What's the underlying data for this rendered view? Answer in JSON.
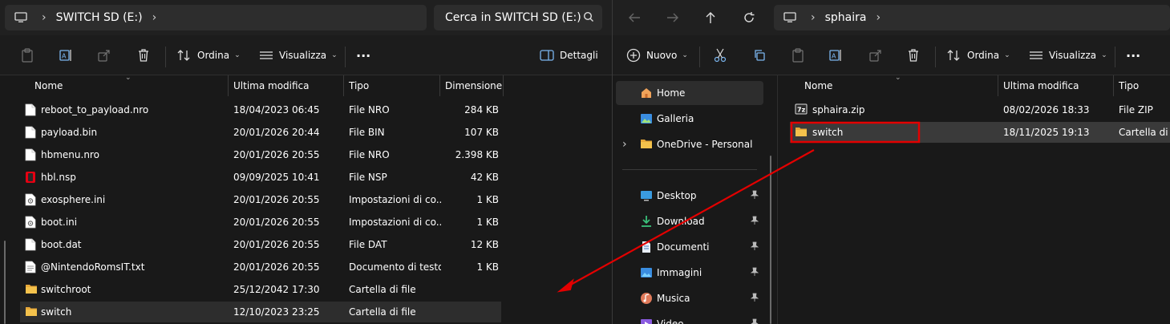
{
  "left": {
    "address": {
      "crumb": "SWITCH SD (E:)"
    },
    "search_placeholder": "Cerca in SWITCH SD (E:)",
    "toolbar": {
      "details_label": "Dettagli",
      "sort_label": "Ordina",
      "view_label": "Visualizza",
      "more": "···"
    },
    "columns": {
      "name": "Nome",
      "modified": "Ultima modifica",
      "type": "Tipo",
      "size": "Dimensione"
    },
    "files": [
      {
        "name": "reboot_to_payload.nro",
        "modified": "18/04/2023 06:45",
        "type": "File NRO",
        "size": "284 KB",
        "icon": "file-icon"
      },
      {
        "name": "payload.bin",
        "modified": "20/01/2026 20:44",
        "type": "File BIN",
        "size": "107 KB",
        "icon": "file-icon"
      },
      {
        "name": "hbmenu.nro",
        "modified": "20/01/2026 20:55",
        "type": "File NRO",
        "size": "2.398 KB",
        "icon": "file-icon"
      },
      {
        "name": "hbl.nsp",
        "modified": "09/09/2025 10:41",
        "type": "File NSP",
        "size": "42 KB",
        "icon": "switch-nsp-icon"
      },
      {
        "name": "exosphere.ini",
        "modified": "20/01/2026 20:55",
        "type": "Impostazioni di co...",
        "size": "1 KB",
        "icon": "settings-file-icon"
      },
      {
        "name": "boot.ini",
        "modified": "20/01/2026 20:55",
        "type": "Impostazioni di co...",
        "size": "1 KB",
        "icon": "settings-file-icon"
      },
      {
        "name": "boot.dat",
        "modified": "20/01/2026 20:55",
        "type": "File DAT",
        "size": "12 KB",
        "icon": "file-icon"
      },
      {
        "name": "@NintendoRomsIT.txt",
        "modified": "20/01/2026 20:55",
        "type": "Documento di testo",
        "size": "1 KB",
        "icon": "text-file-icon"
      },
      {
        "name": "switchroot",
        "modified": "25/12/2042 17:30",
        "type": "Cartella di file",
        "size": "",
        "icon": "folder-icon"
      },
      {
        "name": "switch",
        "modified": "12/10/2023 23:25",
        "type": "Cartella di file",
        "size": "",
        "icon": "folder-icon"
      }
    ]
  },
  "right": {
    "address": {
      "crumb": "sphaira"
    },
    "toolbar": {
      "new_label": "Nuovo",
      "sort_label": "Ordina",
      "view_label": "Visualizza",
      "more": "···"
    },
    "nav": [
      {
        "label": "Home",
        "icon": "home-icon"
      },
      {
        "label": "Galleria",
        "icon": "gallery-icon"
      },
      {
        "label": "OneDrive - Personal",
        "icon": "folder-icon"
      },
      {
        "label": "Desktop",
        "icon": "desktop-icon"
      },
      {
        "label": "Download",
        "icon": "download-icon"
      },
      {
        "label": "Documenti",
        "icon": "documents-icon"
      },
      {
        "label": "Immagini",
        "icon": "pictures-icon"
      },
      {
        "label": "Musica",
        "icon": "music-icon"
      },
      {
        "label": "Video",
        "icon": "video-icon"
      }
    ],
    "columns": {
      "name": "Nome",
      "modified": "Ultima modifica",
      "type": "Tipo"
    },
    "files": [
      {
        "name": "sphaira.zip",
        "modified": "08/02/2026 18:33",
        "type": "File ZIP",
        "icon": "zip-icon"
      },
      {
        "name": "switch",
        "modified": "18/11/2025 19:13",
        "type": "Cartella di file",
        "icon": "folder-icon"
      }
    ]
  },
  "colors": {
    "highlight": "#e30000",
    "folder": "#f4c24c",
    "selection": "#3a3a3a"
  }
}
